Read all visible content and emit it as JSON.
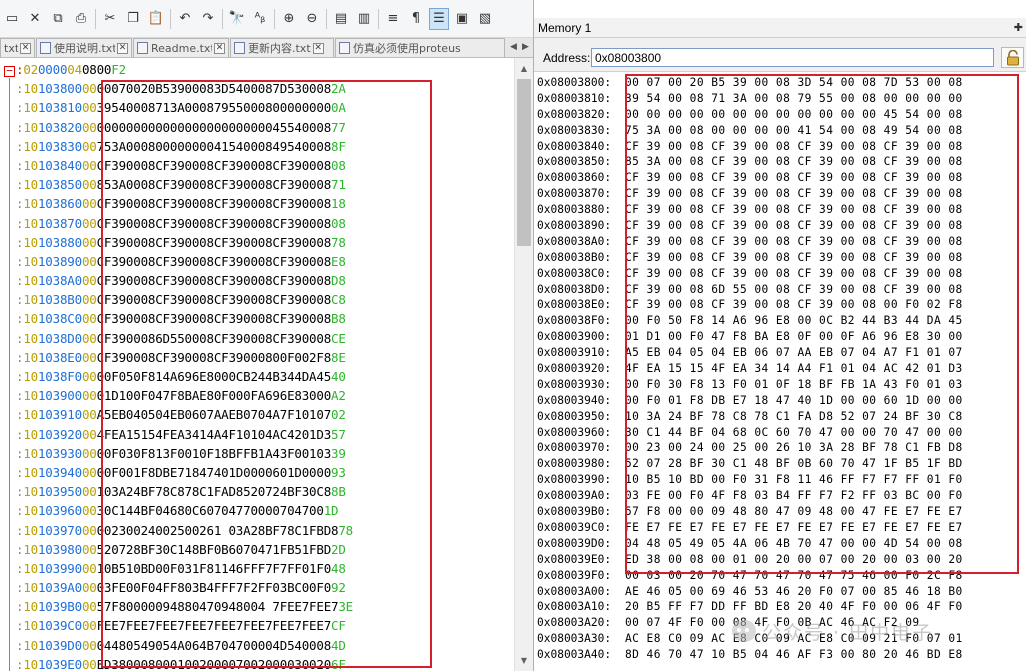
{
  "editor": {
    "tabs": [
      {
        "label": "txt"
      },
      {
        "label": "使用说明.txt"
      },
      {
        "label": "Readme.txt"
      },
      {
        "label": "更新内容.txt"
      },
      {
        "label": "仿真必须使用proteus"
      }
    ],
    "collapse_glyph": "−",
    "first_line": {
      "colon": ":",
      "len": "02",
      "addr": "0000",
      "type": "04",
      "data": "0800",
      "chk": "F2"
    },
    "lines": [
      {
        "addr": "103800",
        "data": "00070020B53900083D5400087D530008",
        "chk": "2A"
      },
      {
        "addr": "103810",
        "data": "39540008713A00087955000800000000",
        "chk": "0A"
      },
      {
        "addr": "103820",
        "data": "00000000000000000000000045540008",
        "chk": "77"
      },
      {
        "addr": "103830",
        "data": "753A0008000000004154000849540008",
        "chk": "8F"
      },
      {
        "addr": "103840",
        "data": "CF390008CF390008CF390008CF390008",
        "chk": "08"
      },
      {
        "addr": "103850",
        "data": "853A0008CF390008CF390008CF390008",
        "chk": "71"
      },
      {
        "addr": "103860",
        "data": "CF390008CF390008CF390008CF390008",
        "chk": "18"
      },
      {
        "addr": "103870",
        "data": "CF390008CF390008CF390008CF390008",
        "chk": "08"
      },
      {
        "addr": "103880",
        "data": "CF390008CF390008CF390008CF390008",
        "chk": "78"
      },
      {
        "addr": "103890",
        "data": "CF390008CF390008CF390008CF390008",
        "chk": "E8"
      },
      {
        "addr": "1038A0",
        "data": "CF390008CF390008CF390008CF390008",
        "chk": "D8"
      },
      {
        "addr": "1038B0",
        "data": "CF390008CF390008CF390008CF390008",
        "chk": "C8"
      },
      {
        "addr": "1038C0",
        "data": "CF390008CF390008CF390008CF390008",
        "chk": "B8"
      },
      {
        "addr": "1038D0",
        "data": "CF3900086D550008CF390008CF390008",
        "chk": "CE"
      },
      {
        "addr": "1038E0",
        "data": "CF390008CF390008CF39000800F002F8",
        "chk": "8E"
      },
      {
        "addr": "1038F0",
        "data": "00F050F814A696E8000CB244B344DA45",
        "chk": "40"
      },
      {
        "addr": "103900",
        "data": "01D100F047F8BAE80F000FA696E83000",
        "chk": "A2"
      },
      {
        "addr": "103910",
        "data": "A5EB040504EB0607AAEB0704A7F10107",
        "chk": "02"
      },
      {
        "addr": "103920",
        "data": "4FEA15154FEA3414A4F10104AC4201D3",
        "chk": "57"
      },
      {
        "addr": "103930",
        "data": "00F030F813F0010F18BFFB1A43F00103",
        "chk": "39"
      },
      {
        "addr": "103940",
        "data": "00F001F8DBE71847401D0000601D0000",
        "chk": "93"
      },
      {
        "addr": "103950",
        "data": "103A24BF78C878C1FAD8520724BF30C8",
        "chk": "8B"
      },
      {
        "addr": "103960",
        "data": "30C144BF04680C60704770000704700",
        "chk": "1D"
      },
      {
        "addr": "103970",
        "data": "00230024002500261 03A28BF78C1FBD8",
        "chk": "78"
      },
      {
        "addr": "103980",
        "data": "520728BF30C148BF0B6070471FB51FBD",
        "chk": "2D"
      },
      {
        "addr": "103990",
        "data": "10B510BD00F031F81146FFF7F7FF01F0",
        "chk": "48"
      },
      {
        "addr": "1039A0",
        "data": "03FE00F04FF803B4FFF7F2FF03BC00F0",
        "chk": "92"
      },
      {
        "addr": "1039B0",
        "data": "57F80000094880470948004 7FEE7FEE7",
        "chk": "3E"
      },
      {
        "addr": "1039C0",
        "data": "FEE7FEE7FEE7FEE7FEE7FEE7FEE7FEE7",
        "chk": "CF"
      },
      {
        "addr": "1039D0",
        "data": "04480549054A064B704700004D540008",
        "chk": "4D"
      },
      {
        "addr": "1039E0",
        "data": "ED380008000100200007002000030020",
        "chk": "6F"
      }
    ]
  },
  "memory": {
    "title": "Memory 1",
    "pin_glyph": "✚",
    "address_label": "Address:",
    "address_value": "0x08003800",
    "rows": [
      {
        "addr": "0x08003800:",
        "bytes": "00 07 00 20 B5 39 00 08 3D 54 00 08 7D 53 00 08"
      },
      {
        "addr": "0x08003810:",
        "bytes": "39 54 00 08 71 3A 00 08 79 55 00 08 00 00 00 00"
      },
      {
        "addr": "0x08003820:",
        "bytes": "00 00 00 00 00 00 00 00 00 00 00 00 45 54 00 08"
      },
      {
        "addr": "0x08003830:",
        "bytes": "75 3A 00 08 00 00 00 00 41 54 00 08 49 54 00 08"
      },
      {
        "addr": "0x08003840:",
        "bytes": "CF 39 00 08 CF 39 00 08 CF 39 00 08 CF 39 00 08"
      },
      {
        "addr": "0x08003850:",
        "bytes": "85 3A 00 08 CF 39 00 08 CF 39 00 08 CF 39 00 08"
      },
      {
        "addr": "0x08003860:",
        "bytes": "CF 39 00 08 CF 39 00 08 CF 39 00 08 CF 39 00 08"
      },
      {
        "addr": "0x08003870:",
        "bytes": "CF 39 00 08 CF 39 00 08 CF 39 00 08 CF 39 00 08"
      },
      {
        "addr": "0x08003880:",
        "bytes": "CF 39 00 08 CF 39 00 08 CF 39 00 08 CF 39 00 08"
      },
      {
        "addr": "0x08003890:",
        "bytes": "CF 39 00 08 CF 39 00 08 CF 39 00 08 CF 39 00 08"
      },
      {
        "addr": "0x080038A0:",
        "bytes": "CF 39 00 08 CF 39 00 08 CF 39 00 08 CF 39 00 08"
      },
      {
        "addr": "0x080038B0:",
        "bytes": "CF 39 00 08 CF 39 00 08 CF 39 00 08 CF 39 00 08"
      },
      {
        "addr": "0x080038C0:",
        "bytes": "CF 39 00 08 CF 39 00 08 CF 39 00 08 CF 39 00 08"
      },
      {
        "addr": "0x080038D0:",
        "bytes": "CF 39 00 08 6D 55 00 08 CF 39 00 08 CF 39 00 08"
      },
      {
        "addr": "0x080038E0:",
        "bytes": "CF 39 00 08 CF 39 00 08 CF 39 00 08 00 F0 02 F8"
      },
      {
        "addr": "0x080038F0:",
        "bytes": "00 F0 50 F8 14 A6 96 E8 00 0C B2 44 B3 44 DA 45"
      },
      {
        "addr": "0x08003900:",
        "bytes": "01 D1 00 F0 47 F8 BA E8 0F 00 0F A6 96 E8 30 00"
      },
      {
        "addr": "0x08003910:",
        "bytes": "A5 EB 04 05 04 EB 06 07 AA EB 07 04 A7 F1 01 07"
      },
      {
        "addr": "0x08003920:",
        "bytes": "4F EA 15 15 4F EA 34 14 A4 F1 01 04 AC 42 01 D3"
      },
      {
        "addr": "0x08003930:",
        "bytes": "00 F0 30 F8 13 F0 01 0F 18 BF FB 1A 43 F0 01 03"
      },
      {
        "addr": "0x08003940:",
        "bytes": "00 F0 01 F8 DB E7 18 47 40 1D 00 00 60 1D 00 00"
      },
      {
        "addr": "0x08003950:",
        "bytes": "10 3A 24 BF 78 C8 78 C1 FA D8 52 07 24 BF 30 C8"
      },
      {
        "addr": "0x08003960:",
        "bytes": "30 C1 44 BF 04 68 0C 60 70 47 00 00 70 47 00 00"
      },
      {
        "addr": "0x08003970:",
        "bytes": "00 23 00 24 00 25 00 26 10 3A 28 BF 78 C1 FB D8"
      },
      {
        "addr": "0x08003980:",
        "bytes": "52 07 28 BF 30 C1 48 BF 0B 60 70 47 1F B5 1F BD"
      },
      {
        "addr": "0x08003990:",
        "bytes": "10 B5 10 BD 00 F0 31 F8 11 46 FF F7 F7 FF 01 F0"
      },
      {
        "addr": "0x080039A0:",
        "bytes": "03 FE 00 F0 4F F8 03 B4 FF F7 F2 FF 03 BC 00 F0"
      },
      {
        "addr": "0x080039B0:",
        "bytes": "57 F8 00 00 09 48 80 47 09 48 00 47 FE E7 FE E7"
      },
      {
        "addr": "0x080039C0:",
        "bytes": "FE E7 FE E7 FE E7 FE E7 FE E7 FE E7 FE E7 FE E7"
      },
      {
        "addr": "0x080039D0:",
        "bytes": "04 48 05 49 05 4A 06 4B 70 47 00 00 4D 54 00 08"
      },
      {
        "addr": "0x080039E0:",
        "bytes": "ED 38 00 08 00 01 00 20 00 07 00 20 00 03 00 20"
      },
      {
        "addr": "0x080039F0:",
        "bytes": "00 03 00 20 70 47 70 47 70 47 75 46 00 F0 2C F8"
      },
      {
        "addr": "0x08003A00:",
        "bytes": "AE 46 05 00 69 46 53 46 20 F0 07 00 85 46 18 B0"
      },
      {
        "addr": "0x08003A10:",
        "bytes": "20 B5 FF F7 DD FF BD E8 20 40 4F F0 00 06 4F F0"
      },
      {
        "addr": "0x08003A20:",
        "bytes": "00 07 4F F0 00 08 4F F0 0B AC 46 AC F2 09"
      },
      {
        "addr": "0x08003A30:",
        "bytes": "AC E8 C0 09 AC E8 C0 09 AC E8 C0 09 21 F0 07 01"
      },
      {
        "addr": "0x08003A40:",
        "bytes": "8D 46 70 47 10 B5 04 46 AF F3 00 80 20 46 BD E8"
      }
    ]
  },
  "watermark": {
    "text": "公众号 · 田中电子"
  }
}
